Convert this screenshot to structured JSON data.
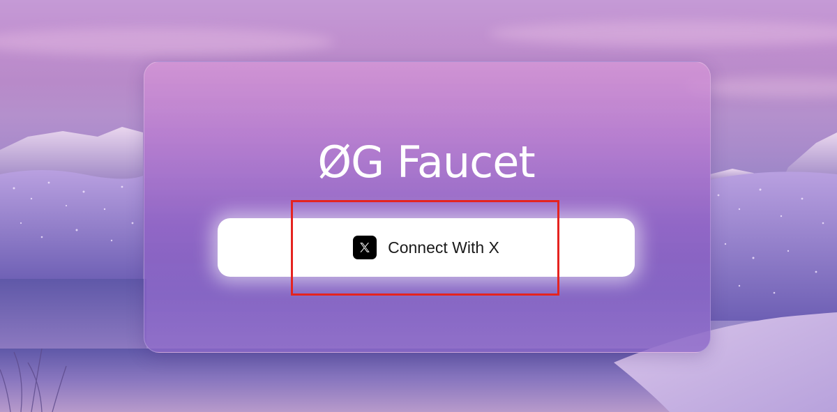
{
  "page": {
    "title": "ØG Faucet"
  },
  "connect_button": {
    "label": "Connect With X",
    "icon": "x-logo-icon"
  },
  "colors": {
    "accent_highlight": "#e5231f",
    "button_background": "#ffffff",
    "icon_background": "#000000",
    "title_text": "#ffffff"
  }
}
